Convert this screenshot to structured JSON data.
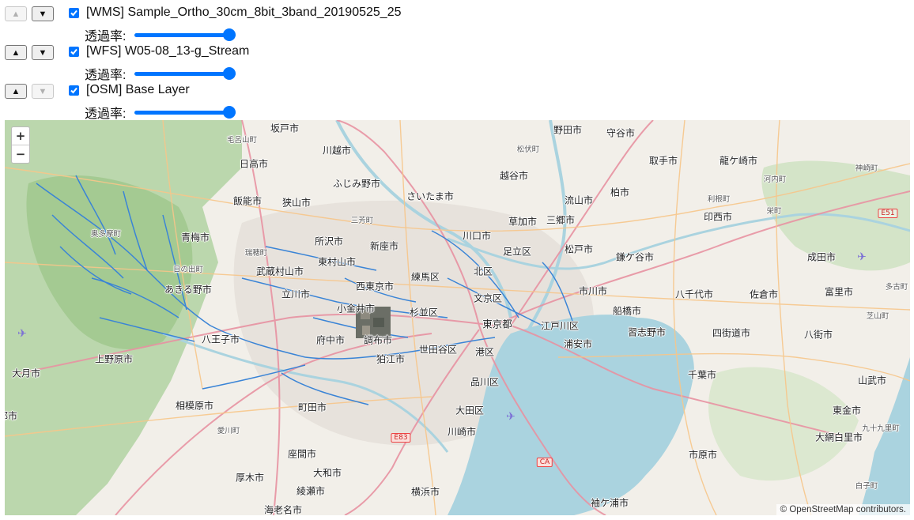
{
  "layers": [
    {
      "name": "[WMS] Sample_Ortho_30cm_8bit_3band_20190525_25",
      "checked": true,
      "opacity": 1.0,
      "up_enabled": false,
      "down_enabled": true
    },
    {
      "name": "[WFS] W05-08_13-g_Stream",
      "checked": true,
      "opacity": 1.0,
      "up_enabled": true,
      "down_enabled": true
    },
    {
      "name": "[OSM] Base Layer",
      "checked": true,
      "opacity": 1.0,
      "up_enabled": true,
      "down_enabled": false
    }
  ],
  "labels": {
    "up": "▲",
    "down": "▼",
    "opacity": "透過率:"
  },
  "map": {
    "zoom_in": "+",
    "zoom_out": "−",
    "attribution": "© OpenStreetMap contributors.",
    "colors": {
      "water": "#aad3df",
      "land": "#f2efe9",
      "forest": "#add19e",
      "stream": "#3a84d6",
      "road_major": "#e892a2",
      "road_secondary": "#f7c68a"
    },
    "place_labels": [
      [
        "坂戸市",
        "normal"
      ],
      [
        "野田市",
        "normal"
      ],
      [
        "守谷市",
        "normal"
      ],
      [
        "毛呂山町",
        "small"
      ],
      [
        "川越市",
        "normal"
      ],
      [
        "松伏町",
        "small"
      ],
      [
        "日高市",
        "normal"
      ],
      [
        "越谷市",
        "normal"
      ],
      [
        "取手市",
        "normal"
      ],
      [
        "龍ケ崎市",
        "normal"
      ],
      [
        "ふじみ野市",
        "normal"
      ],
      [
        "神崎町",
        "small"
      ],
      [
        "さいたま市",
        "normal"
      ],
      [
        "飯能市",
        "normal"
      ],
      [
        "狭山市",
        "normal"
      ],
      [
        "流山市",
        "normal"
      ],
      [
        "柏市",
        "normal"
      ],
      [
        "河内町",
        "small"
      ],
      [
        "利根町",
        "small"
      ],
      [
        "栄町",
        "small"
      ],
      [
        "三芳町",
        "small"
      ],
      [
        "草加市",
        "normal"
      ],
      [
        "三郷市",
        "normal"
      ],
      [
        "印西市",
        "normal"
      ],
      [
        "E51",
        "hwy-green"
      ],
      [
        "青梅市",
        "normal"
      ],
      [
        "所沢市",
        "normal"
      ],
      [
        "川口市",
        "normal"
      ],
      [
        "奥多摩町",
        "small"
      ],
      [
        "瑞穂町",
        "small"
      ],
      [
        "新座市",
        "normal"
      ],
      [
        "松戸市",
        "normal"
      ],
      [
        "足立区",
        "normal"
      ],
      [
        "鎌ケ谷市",
        "normal"
      ],
      [
        "成田市",
        "normal"
      ],
      [
        "東村山市",
        "normal"
      ],
      [
        "日の出町",
        "small"
      ],
      [
        "武蔵村山市",
        "normal"
      ],
      [
        "北区",
        "normal"
      ],
      [
        "練馬区",
        "normal"
      ],
      [
        "多古町",
        "small"
      ],
      [
        "あきる野市",
        "normal"
      ],
      [
        "西東京市",
        "normal"
      ],
      [
        "市川市",
        "normal"
      ],
      [
        "八千代市",
        "normal"
      ],
      [
        "佐倉市",
        "normal"
      ],
      [
        "富里市",
        "normal"
      ],
      [
        "立川市",
        "normal"
      ],
      [
        "文京区",
        "normal"
      ],
      [
        "小金井市",
        "normal"
      ],
      [
        "芝山町",
        "small"
      ],
      [
        "杉並区",
        "normal"
      ],
      [
        "船橋市",
        "normal"
      ],
      [
        "東京都",
        "big"
      ],
      [
        "江戸川区",
        "normal"
      ],
      [
        "習志野市",
        "normal"
      ],
      [
        "四街道市",
        "normal"
      ],
      [
        "八王子市",
        "normal"
      ],
      [
        "府中市",
        "normal"
      ],
      [
        "調布市",
        "normal"
      ],
      [
        "八街市",
        "normal"
      ],
      [
        "世田谷区",
        "normal"
      ],
      [
        "港区",
        "normal"
      ],
      [
        "浦安市",
        "normal"
      ],
      [
        "上野原市",
        "normal"
      ],
      [
        "狛江市",
        "normal"
      ],
      [
        "大月市",
        "normal"
      ],
      [
        "千葉市",
        "normal"
      ],
      [
        "品川区",
        "normal"
      ],
      [
        "山武市",
        "normal"
      ],
      [
        "相模原市",
        "normal"
      ],
      [
        "町田市",
        "normal"
      ],
      [
        "大田区",
        "normal"
      ],
      [
        "東金市",
        "normal"
      ],
      [
        "都市",
        "normal"
      ],
      [
        "愛川町",
        "small"
      ],
      [
        "川崎市",
        "normal"
      ],
      [
        "E83",
        "hwy-red"
      ],
      [
        "大網白里市",
        "normal"
      ],
      [
        "九十九里町",
        "small"
      ],
      [
        "座間市",
        "normal"
      ],
      [
        "CA",
        "hwy-red"
      ],
      [
        "市原市",
        "normal"
      ],
      [
        "大和市",
        "normal"
      ],
      [
        "厚木市",
        "normal"
      ],
      [
        "綾瀬市",
        "normal"
      ],
      [
        "横浜市",
        "normal"
      ],
      [
        "白子町",
        "small"
      ],
      [
        "袖ケ浦市",
        "normal"
      ],
      [
        "海老名市",
        "normal"
      ]
    ]
  }
}
